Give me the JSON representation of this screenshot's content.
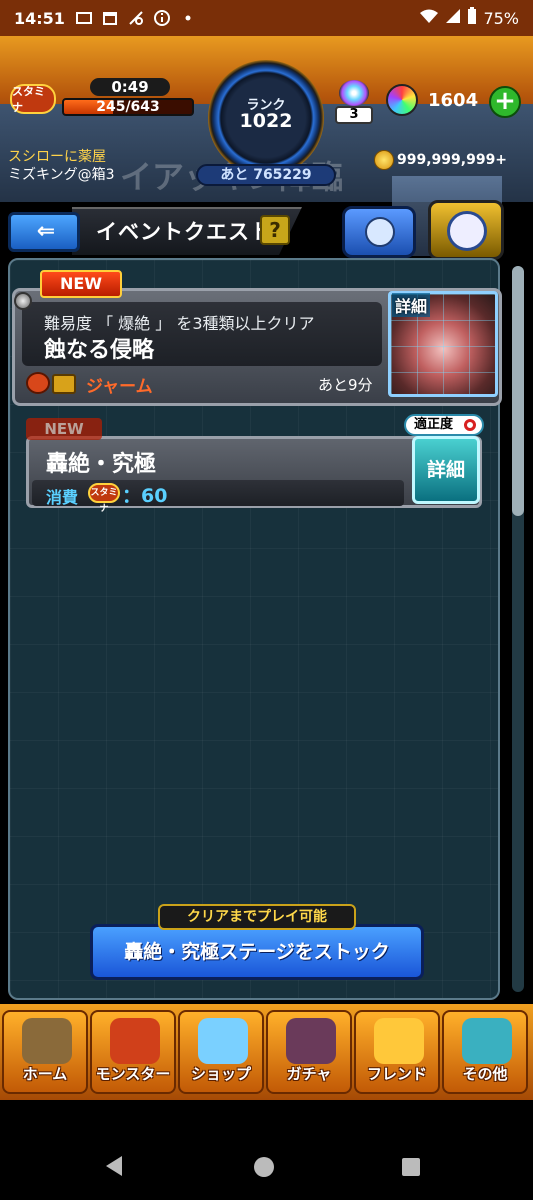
{
  "status_bar": {
    "time": "14:51",
    "battery": "75%"
  },
  "top": {
    "stamina_label": "スタミナ",
    "stamina_timer": "0:49",
    "stamina_value": "245/643",
    "stamina_fraction": 0.381,
    "rank_label": "ランク",
    "rank_value": "1022",
    "rank_next": "あと 765229",
    "orb_slot_count": "3",
    "orb_count": "1604",
    "plus": "+",
    "coins": "999,999,999+",
    "notice": "スシローに薬屋",
    "strike_name": "ミズキング@箱3",
    "bg_title": "イアッキン降臨"
  },
  "header": {
    "back_arrow": "⇐",
    "title": "イベントクエスト",
    "help": "?"
  },
  "mission": {
    "new_badge": "NEW",
    "condition": "難易度 「 爆絶 」 を3種類以上クリア",
    "name": "蝕なる侵略",
    "boss": "ジャーム",
    "remaining": "あと9分",
    "detail": "詳細"
  },
  "quest": {
    "new_badge": "NEW",
    "name": "轟絶・究極",
    "cost_label": "消費",
    "cost_icon": "スタミナ",
    "cost_value": "：60",
    "aptitude": "適正度",
    "detail": "詳細"
  },
  "stock": {
    "hint": "クリアまでプレイ可能",
    "button": "轟絶・究極ステージをストック"
  },
  "tabs": [
    {
      "label": "ホーム",
      "color": "#8a6a3a"
    },
    {
      "label": "モンスター",
      "color": "#d0401a"
    },
    {
      "label": "ショップ",
      "color": "#7ad0ff"
    },
    {
      "label": "ガチャ",
      "color": "#6a3a5a"
    },
    {
      "label": "フレンド",
      "color": "#ffc83a"
    },
    {
      "label": "その他",
      "color": "#3ab0c0"
    }
  ]
}
